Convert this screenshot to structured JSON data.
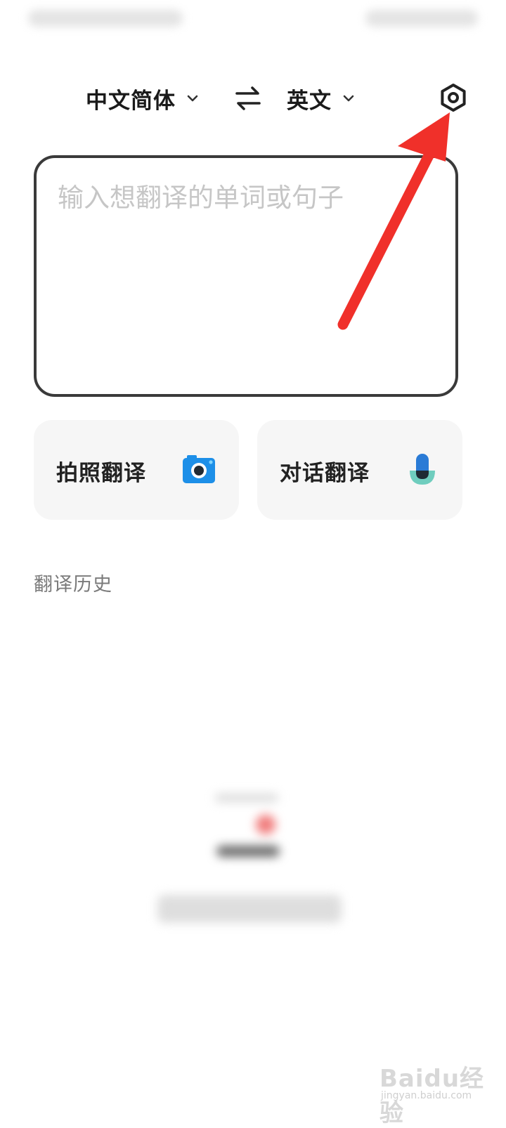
{
  "lang_bar": {
    "source_label": "中文简体",
    "target_label": "英文"
  },
  "input": {
    "placeholder": "输入想翻译的单词或句子",
    "value": ""
  },
  "actions": {
    "photo_label": "拍照翻译",
    "dialog_label": "对话翻译"
  },
  "history": {
    "title": "翻译历史"
  },
  "icons": {
    "chevron": "chevron-down-icon",
    "swap": "swap-arrows-icon",
    "settings": "hexagon-gear-icon",
    "camera": "camera-icon",
    "microphone": "microphone-icon"
  },
  "colors": {
    "camera_blue": "#1d8fe8",
    "mic_blue": "#2a7bd6",
    "mic_teal": "#6fcdbe",
    "annotation_red": "#f0302a"
  },
  "watermark": {
    "main": "Baidu经验",
    "sub": "jingyan.baidu.com"
  }
}
